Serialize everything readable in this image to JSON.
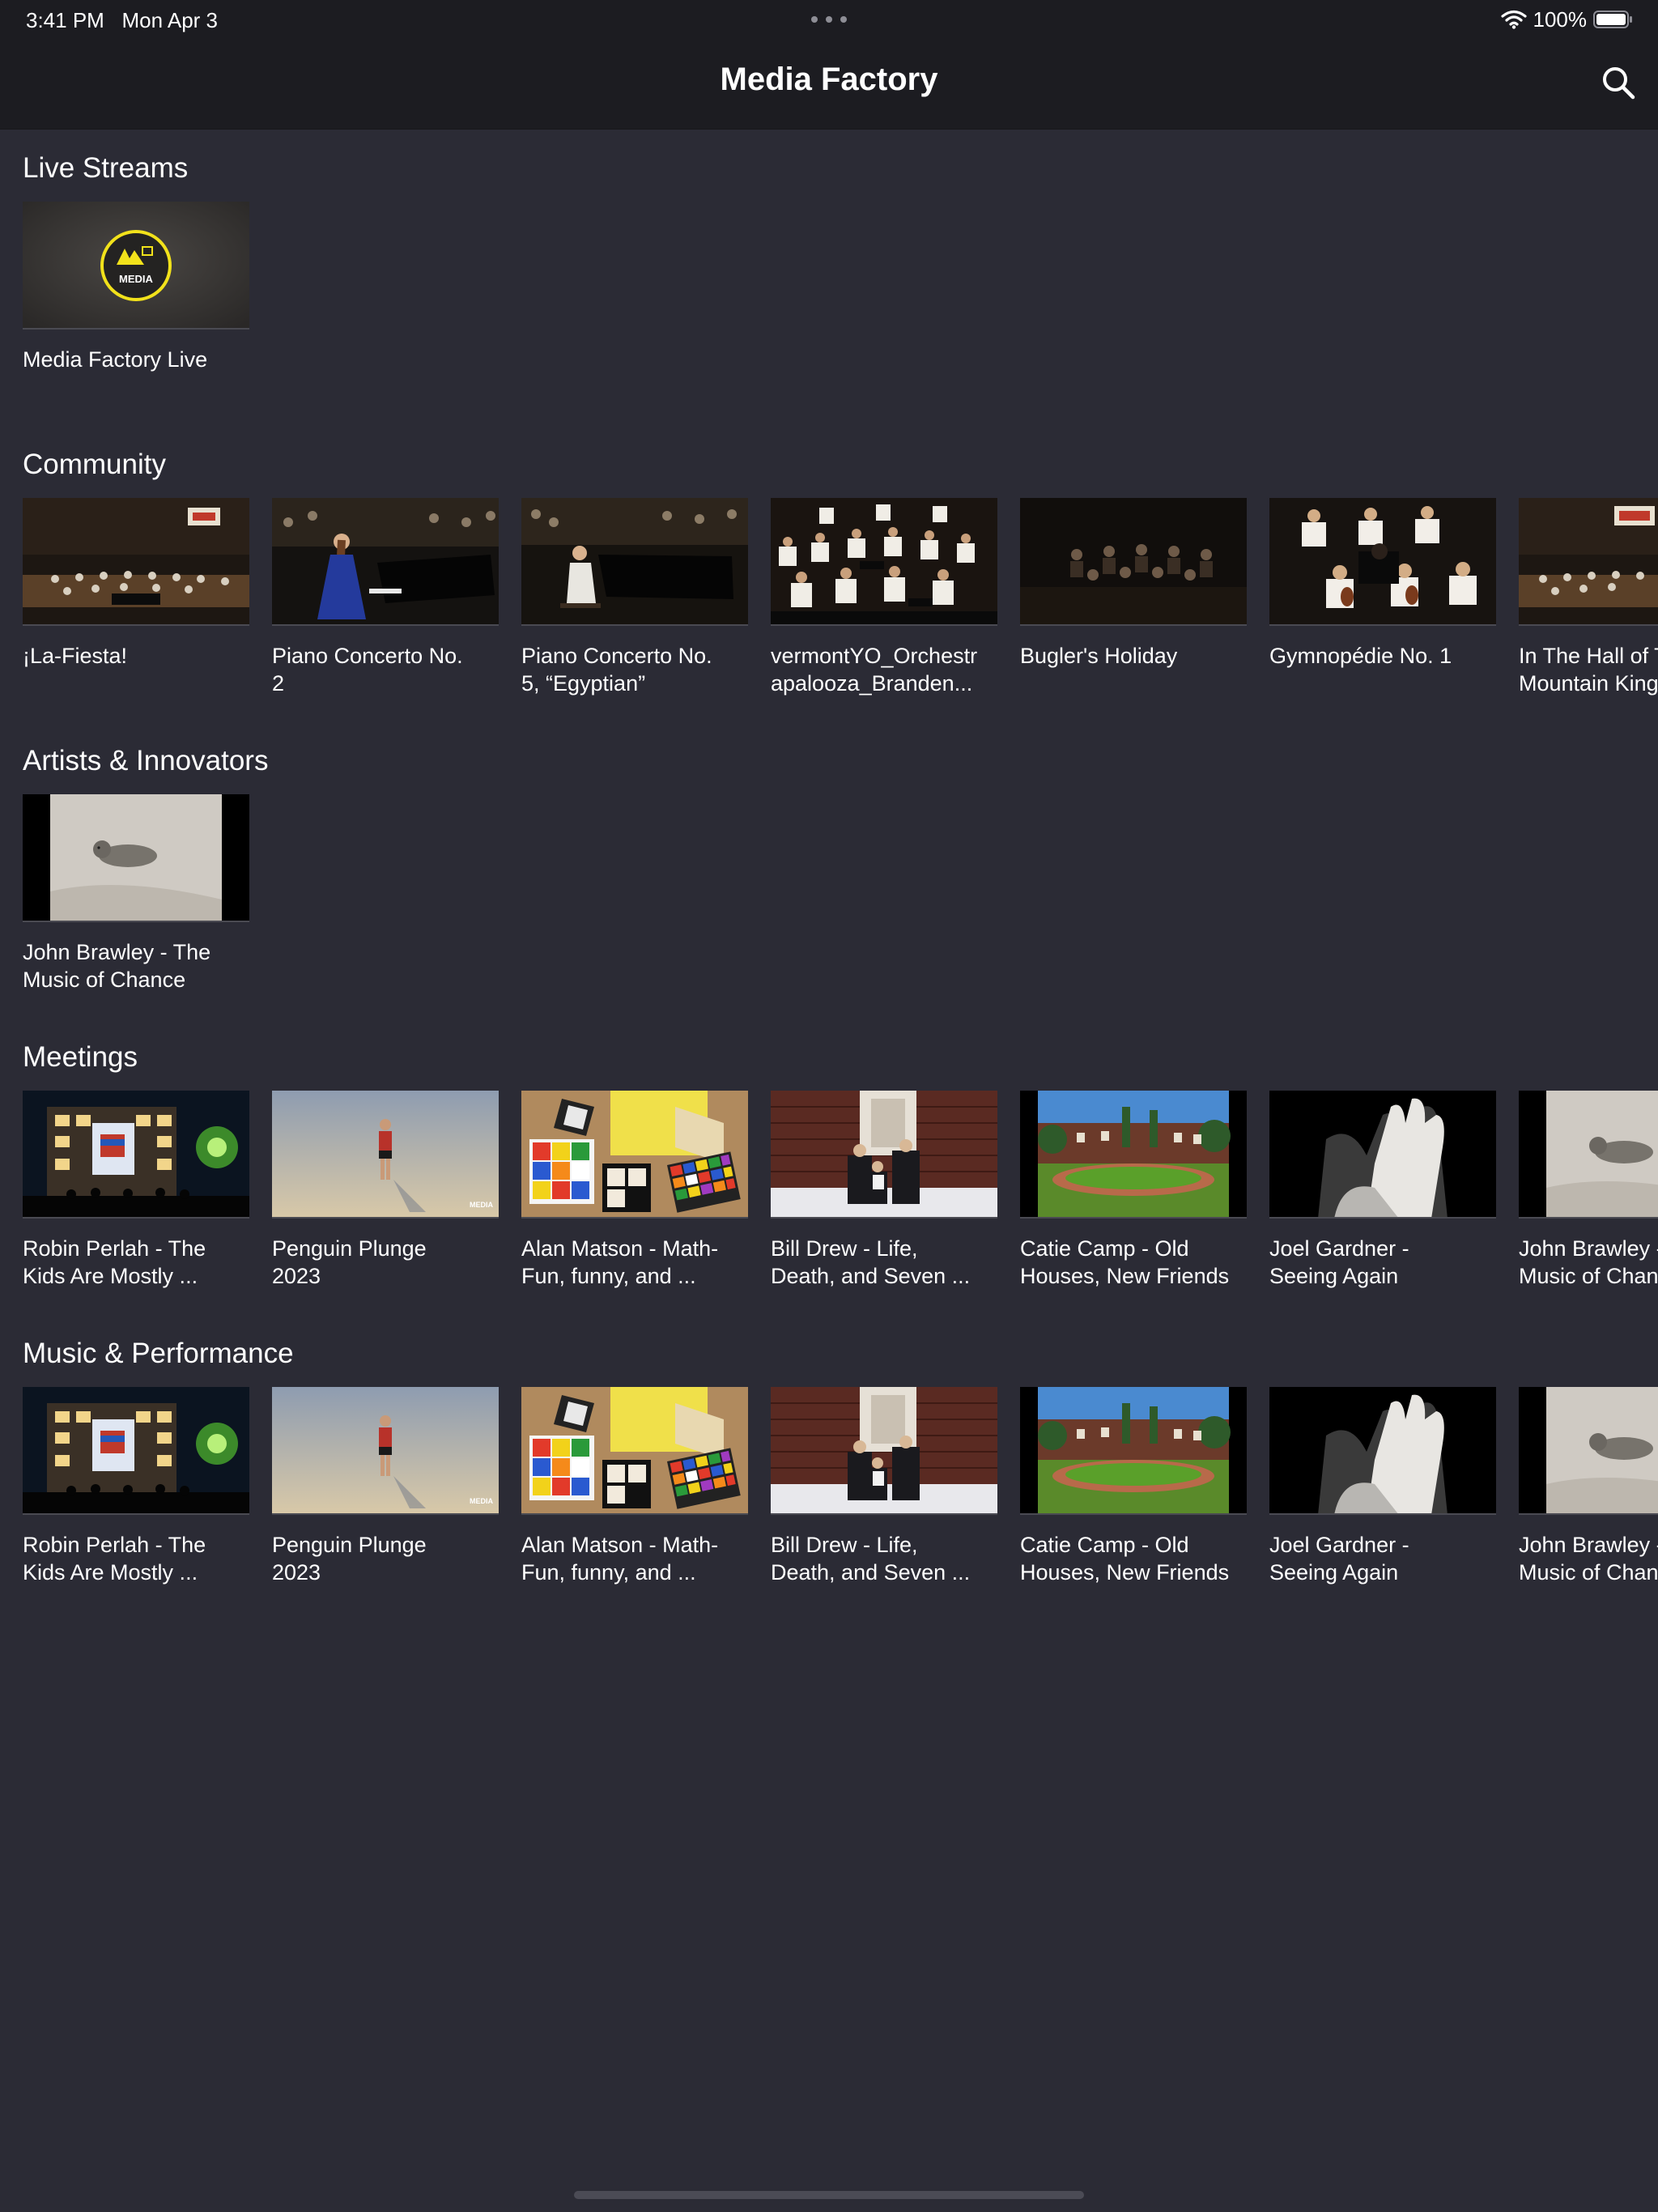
{
  "status": {
    "time": "3:41 PM",
    "date": "Mon Apr 3",
    "battery": "100%"
  },
  "nav": {
    "title": "Media Factory",
    "search_icon": "search-icon"
  },
  "colors": {
    "background": "#2b2b35",
    "bar": "#1c1c21",
    "logo_yellow": "#f2e21b"
  },
  "live": {
    "title": "Live Streams",
    "items": [
      {
        "label": "Media Factory Live",
        "logo_text": "MEDIA"
      }
    ]
  },
  "community": {
    "title": "Community",
    "items": [
      {
        "label": "¡La-Fiesta!"
      },
      {
        "label": "Piano Concerto No.\n2"
      },
      {
        "label": "Piano Concerto No.\n5, “Egyptian”"
      },
      {
        "label": "vermontYO_Orchestr\napalooza_Branden..."
      },
      {
        "label": "Bugler's Holiday"
      },
      {
        "label": "Gymnopédie No. 1"
      },
      {
        "label": "In The Hall of The\nMountain King"
      }
    ]
  },
  "artists": {
    "title": "Artists & Innovators",
    "items": [
      {
        "label": "John Brawley - The\nMusic of Chance"
      }
    ]
  },
  "meetings": {
    "title": "Meetings",
    "items": [
      {
        "label": "Robin Perlah - The\nKids Are Mostly ..."
      },
      {
        "label": "Penguin Plunge\n2023"
      },
      {
        "label": "Alan Matson - Math-\nFun, funny, and ..."
      },
      {
        "label": "Bill Drew - Life,\nDeath, and Seven ..."
      },
      {
        "label": "Catie Camp - Old\nHouses, New Friends"
      },
      {
        "label": "Joel Gardner -\nSeeing Again"
      },
      {
        "label": "John Brawley - The\nMusic of Chance"
      }
    ]
  },
  "music": {
    "title": "Music & Performance",
    "items": [
      {
        "label": "Robin Perlah - The\nKids Are Mostly ..."
      },
      {
        "label": "Penguin Plunge\n2023"
      },
      {
        "label": "Alan Matson - Math-\nFun, funny, and ..."
      },
      {
        "label": "Bill Drew - Life,\nDeath, and Seven ..."
      },
      {
        "label": "Catie Camp - Old\nHouses, New Friends"
      },
      {
        "label": "Joel Gardner -\nSeeing Again"
      },
      {
        "label": "John Brawley - The\nMusic of Chance"
      }
    ]
  }
}
